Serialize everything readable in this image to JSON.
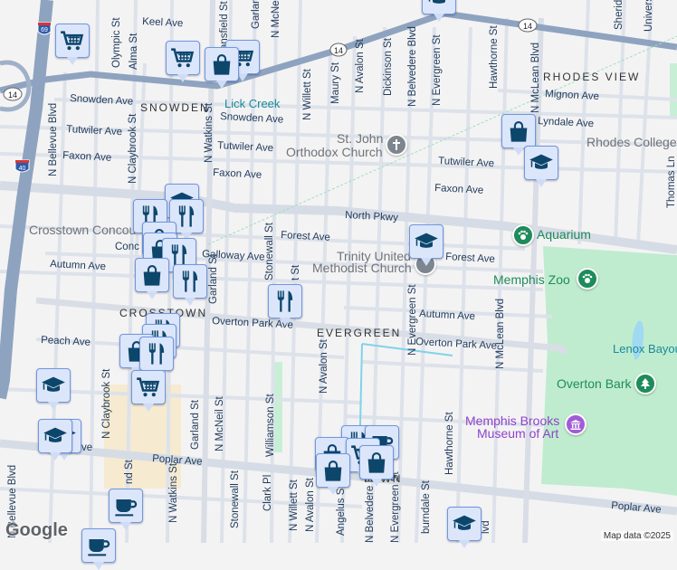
{
  "map": {
    "route_shield": "14",
    "interstates": [
      "69",
      "40"
    ],
    "neighborhoods": {
      "snowden": "SNOWDEN",
      "rhodes_view": "RHODES VIEW",
      "crosstown": "CROSSTOWN",
      "evergreen": "EVERGREEN",
      "midtown_partial": "TOWN"
    },
    "streets": {
      "keel": "Keel Ave",
      "snowden1": "Snowden Ave",
      "snowden2": "Snowden Ave",
      "tutwiler1": "Tutwiler Ave",
      "tutwiler2": "Tutwiler Ave",
      "tutwiler3": "Tutwiler Ave",
      "faxon1": "Faxon Ave",
      "faxon2": "Faxon Ave",
      "faxon3": "Faxon Ave",
      "north_pkwy": "North Pkwy",
      "forest1": "Forest Ave",
      "forest2": "Forest Ave",
      "galloway": "Galloway Ave",
      "autumn1": "Autumn Ave",
      "autumn2": "Autumn Ave",
      "overton1": "Overton Park Ave",
      "overton2": "Overton Park Ave",
      "peach": "Peach Ave",
      "poplar1": "Poplar Ave",
      "poplar2": "Poplar Ave",
      "mignon": "Mignon Ave",
      "lyndale": "Lyndale Ave",
      "conc": "Conc",
      "ve_partial": "ve",
      "olympic": "Olympic St",
      "alma": "Alma St",
      "mansfield": "ansfield St",
      "garlan": "Garlan",
      "mcnei": "N McNei",
      "bellevue1": "N Bellevue Blvd",
      "claybrook1": "N Claybrook St",
      "watkins1": "N Watkins St",
      "willett1": "N Willett St",
      "maury": "Maury St",
      "avalon1": "N Avalon St",
      "dickinson": "Dickinson St",
      "belvedere1": "N Belvedere Blvd",
      "evergreen1": "N Evergreen St",
      "hawthorne1": "Hawthorne St",
      "mclean1": "N McLean Blvd",
      "sheridan": "Sherida",
      "university": "Univers",
      "thomas": "Thomas Ln",
      "stonewall1": "Stonewall St",
      "t_st": "t St",
      "garland1": "Garland St",
      "evergreen2": "N Evergreen St",
      "mclean2": "N McLean Blvd",
      "avalon2": "N Avalon St",
      "garland2": "Garland St",
      "mcneil2": "N McNeil St",
      "williamson": "Williamson St",
      "stonewall2": "Stonewall St",
      "clark": "Clark Pl",
      "willett2": "N Willett St",
      "avalon3": "N Avalon St",
      "angelus": "Angelus St",
      "belvedere2": "N Belvedere Blvd",
      "evergreen3": "N Evergreen St",
      "hawthorne2": "Hawthorne St",
      "auburndale": "burndale St",
      "watkins2": "N Watkins St",
      "bellevue2": "N Bellevue Blvd",
      "claybrook2": "N Claybrook St",
      "nd_st": "nd St",
      "mclean3": "lvd"
    },
    "places": {
      "lick_creek": "Lick Creek",
      "st_john_1": "St. John",
      "st_john_2": "Orthodox Church",
      "rhodes_college": "Rhodes College",
      "crosstown": "Crosstown Concou",
      "trinity_1": "Trinity United",
      "trinity_2": "Methodist Church",
      "aquarium": "Aquarium",
      "memphis_zoo": "Memphis Zoo",
      "lenox_bayou": "Lenox Bayou",
      "overton_bark": "Overton Bark",
      "brooks_1": "Memphis Brooks",
      "brooks_2": "Museum of Art"
    },
    "colors": {
      "park": "#bfeccf",
      "highway": "#8ea3bf",
      "marker_fill": "#dce6fb",
      "marker_icon": "#0d466b",
      "poi_green": "#1e8c5a",
      "poi_purple": "#8e44c9"
    },
    "attribution": "Map data ©2025",
    "logo": "Google"
  }
}
